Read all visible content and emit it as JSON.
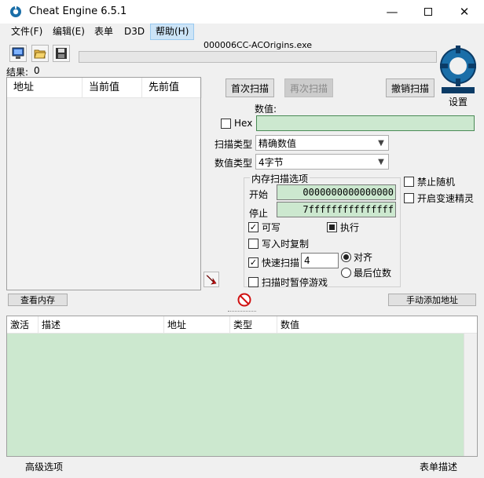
{
  "window": {
    "title": "Cheat Engine 6.5.1"
  },
  "menu": [
    {
      "label": "文件(F)"
    },
    {
      "label": "编辑(E)"
    },
    {
      "label": "表单"
    },
    {
      "label": "D3D"
    },
    {
      "label": "帮助(H)"
    }
  ],
  "process": {
    "name": "000006CC-ACOrigins.exe"
  },
  "results": {
    "label": "结果:",
    "count": "0"
  },
  "result_columns": [
    "地址",
    "当前值",
    "先前值"
  ],
  "scan": {
    "first_scan": "首次扫描",
    "next_scan": "再次扫描",
    "undo_scan": "撤销扫描",
    "settings": "设置",
    "value_label": "数值:",
    "hex_label": "Hex",
    "value": "",
    "scan_type_label": "扫描类型",
    "scan_type": "精确数值",
    "value_type_label": "数值类型",
    "value_type": "4字节"
  },
  "memory_options": {
    "title": "内存扫描选项",
    "start_label": "开始",
    "start": "0000000000000000",
    "stop_label": "停止",
    "stop": "7fffffffffffffff",
    "writable": "可写",
    "executable": "执行",
    "copy_on_write": "写入时复制",
    "fast_scan": "快速扫描",
    "fast_scan_value": "4",
    "align": "对齐",
    "last_digits": "最后位数",
    "pause_game": "扫描时暂停游戏"
  },
  "extra_options": {
    "no_random": "禁止随机",
    "speedhack": "开启变速精灵"
  },
  "buttons": {
    "view_memory": "查看内存",
    "add_address": "手动添加地址"
  },
  "address_columns": [
    "激活",
    "描述",
    "地址",
    "类型",
    "数值"
  ],
  "status": {
    "advanced": "高级选项",
    "table_extras": "表单描述"
  },
  "colors": {
    "value_bg": "#cce8cf",
    "menu_active": "#cce4f7",
    "logo_blue": "#1a6ea8"
  }
}
